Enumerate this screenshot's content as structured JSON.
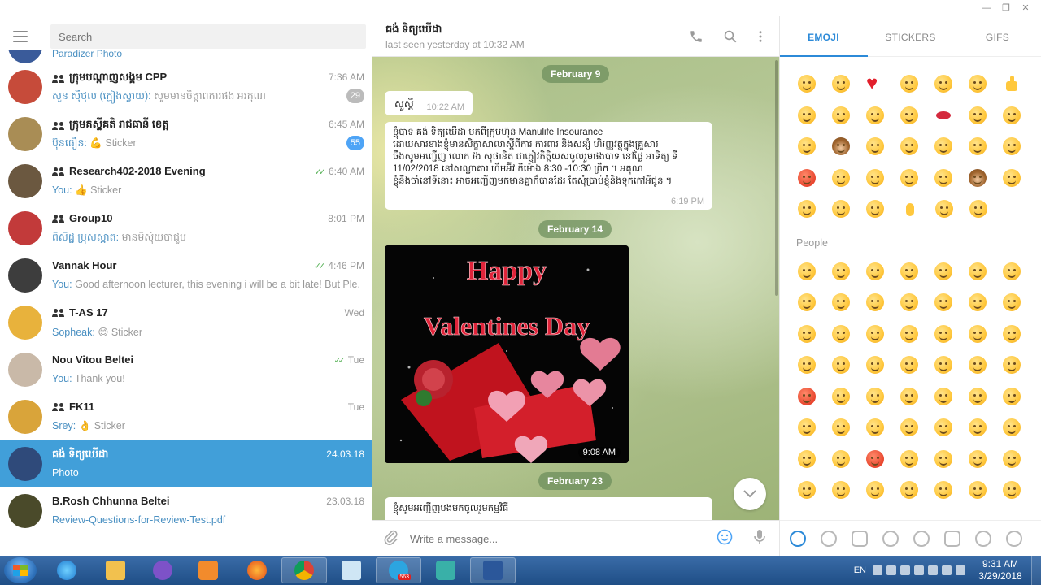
{
  "window": {
    "controls": [
      "—",
      "❐",
      "✕"
    ]
  },
  "sidebar": {
    "search_placeholder": "Search",
    "partial_preview": "Paradizer Photo",
    "chats": [
      {
        "name": "ក្រុមបណ្ដាញសង្គម CPP",
        "group": true,
        "time": "7:36 AM",
        "sender": "សួន សុីថុល (ក្មៀងស្វាយ):",
        "text": "សូមមានចិត្តាពការផង អរគុណ",
        "badge": "29",
        "badge_style": "muted",
        "avatar_color": "#c64b3a"
      },
      {
        "name": "ក្រុមគស្ទីគតិ រាជធានី ខេត្ត",
        "group": true,
        "time": "6:45 AM",
        "sender": "ប៊ុនធឿន:",
        "text": "💪 Sticker",
        "badge": "55",
        "badge_style": "blue",
        "avatar_color": "#a98d55"
      },
      {
        "name": "Research402-2018 Evening",
        "group": true,
        "time": "6:40 AM",
        "checks": true,
        "sender": "You:",
        "text": "👍 Sticker",
        "avatar_color": "#6b5840"
      },
      {
        "name": "Group10",
        "group": true,
        "time": "8:01 PM",
        "sender": "ពិសិដ្ឋ ប្រុសស្អាត:",
        "text": "មានមិសុំយបាជួប",
        "avatar_color": "#c23a3a"
      },
      {
        "name": "Vannak Hour",
        "group": false,
        "time": "4:46 PM",
        "checks": true,
        "sender": "You:",
        "text": "Good afternoon lecturer, this evening i will be a bit late! But Ple...",
        "avatar_color": "#3d3d3d"
      },
      {
        "name": "T-AS 17",
        "group": true,
        "time": "Wed",
        "sender": "Sopheak:",
        "text": "😊 Sticker",
        "avatar_color": "#e8b23c"
      },
      {
        "name": "Nou Vitou Beltei",
        "group": false,
        "time": "Tue",
        "checks": true,
        "sender": "You:",
        "text": "Thank you!",
        "avatar_color": "#c9b9a8"
      },
      {
        "name": "FK11",
        "group": true,
        "time": "Tue",
        "sender": "Srey:",
        "text": "👌 Sticker",
        "avatar_color": "#d9a43a"
      },
      {
        "name": "គង់ ទិត្យឃើដា",
        "group": false,
        "time": "24.03.18",
        "sender": "",
        "text": "Photo",
        "active": true,
        "avatar_color": "#2f4a7a"
      },
      {
        "name": "B.Rosh Chhunna Beltei",
        "group": false,
        "time": "23.03.18",
        "sender": "",
        "text": "Review-Questions-for-Review-Test.pdf",
        "link": true,
        "avatar_color": "#4a4a2a"
      }
    ]
  },
  "chat": {
    "peer_name": "គង់ ទិត្យឃើដា",
    "peer_status": "last seen yesterday at 10:32 AM",
    "icons": [
      "phone-icon",
      "search-icon",
      "more-icon"
    ],
    "dates": [
      "February 9",
      "February 14",
      "February 23"
    ],
    "messages": [
      {
        "text": "សួស្ដី",
        "time": "10:22 AM"
      },
      {
        "text": "ខ្ញុំបាទ គង់ ទិត្យឃើដា មកពីក្រុមហ៊ុន Manulife Insourance\nដោយសារខាងខ្ញុំមានសិក្ខាសាលាស្ដីពីការ ការពារ និងសន្សំ ហិរញ្ញវត្ថុក្នុងគ្រួសារ\nចឹងសូមអញ្ជើញ លោក វង សុផានិត ជាភ្ញៀវកិត្តិយសចូលរួមផងបាទ នៅថ្ងៃ អាទិត្យ ទី\n11/02/2018 នៅសណ្ឋាគារ ហឹមអ៊ីវ កីម៉ោង 8:30 -10:30 ព្រឹក ។ អគុណ\nខ្ញុំនឹងចាំនៅទីនោះ អាចអញ្ជើញមកមានគ្នាក៏បានដែរ តែសុំប្រាប់ខ្ញុំនិងទុកកៅអីជូន ។",
        "time": "6:19 PM"
      },
      {
        "photo_text_line1": "Happy",
        "photo_text_line2": "Valentines Day",
        "time": "9:08 AM"
      },
      {
        "text": "ខ្ញុំសូមអញ្ជើញបងមកចូលរួមកម្មវិធី"
      }
    ]
  },
  "compose": {
    "placeholder": "Write a message..."
  },
  "emoji_panel": {
    "tabs": [
      "EMOJI",
      "STICKERS",
      "GIFS"
    ],
    "active_tab": "EMOJI",
    "section_people": "People",
    "categories": [
      "recent-icon",
      "smile-icon",
      "cat-icon",
      "food-icon",
      "ball-icon",
      "car-icon",
      "bulb-icon",
      "heart-icon"
    ]
  },
  "taskbar": {
    "apps": [
      "internet-explorer-icon",
      "file-explorer-icon",
      "viber-icon",
      "media-player-icon",
      "firefox-icon",
      "chrome-icon",
      "notepad-icon",
      "telegram-icon",
      "app-icon",
      "word-icon"
    ],
    "telegram_badge": "563",
    "lang": "EN",
    "time": "9:31 AM",
    "date": "3/29/2018"
  }
}
